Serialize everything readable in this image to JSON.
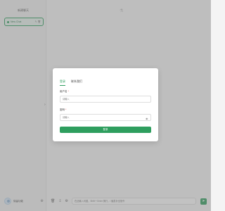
{
  "sidebar": {
    "title": "新建聊天",
    "chat_item": {
      "label": "New Chat",
      "edit_icon": "edit-icon",
      "delete_icon": "delete-icon"
    },
    "user": {
      "name": "保留功能",
      "settings_icon": "gear-icon"
    }
  },
  "main": {
    "top_icon": "robot-icon",
    "input_placeholder": "在此输入问题，Shift + Enter 换行，/ 触发补全指令",
    "send_icon": "send-icon"
  },
  "login_modal": {
    "tabs": [
      {
        "label": "登录",
        "active": true
      },
      {
        "label": "联系我们",
        "active": false
      }
    ],
    "username_label": "用户名",
    "username_placeholder": "请输入",
    "password_label": "密码",
    "password_placeholder": "请输入",
    "required_mark": "*",
    "submit_label": "登录"
  },
  "colors": {
    "accent": "#2e9e5e",
    "required": "#e34d4d",
    "overlay": "#787878"
  }
}
